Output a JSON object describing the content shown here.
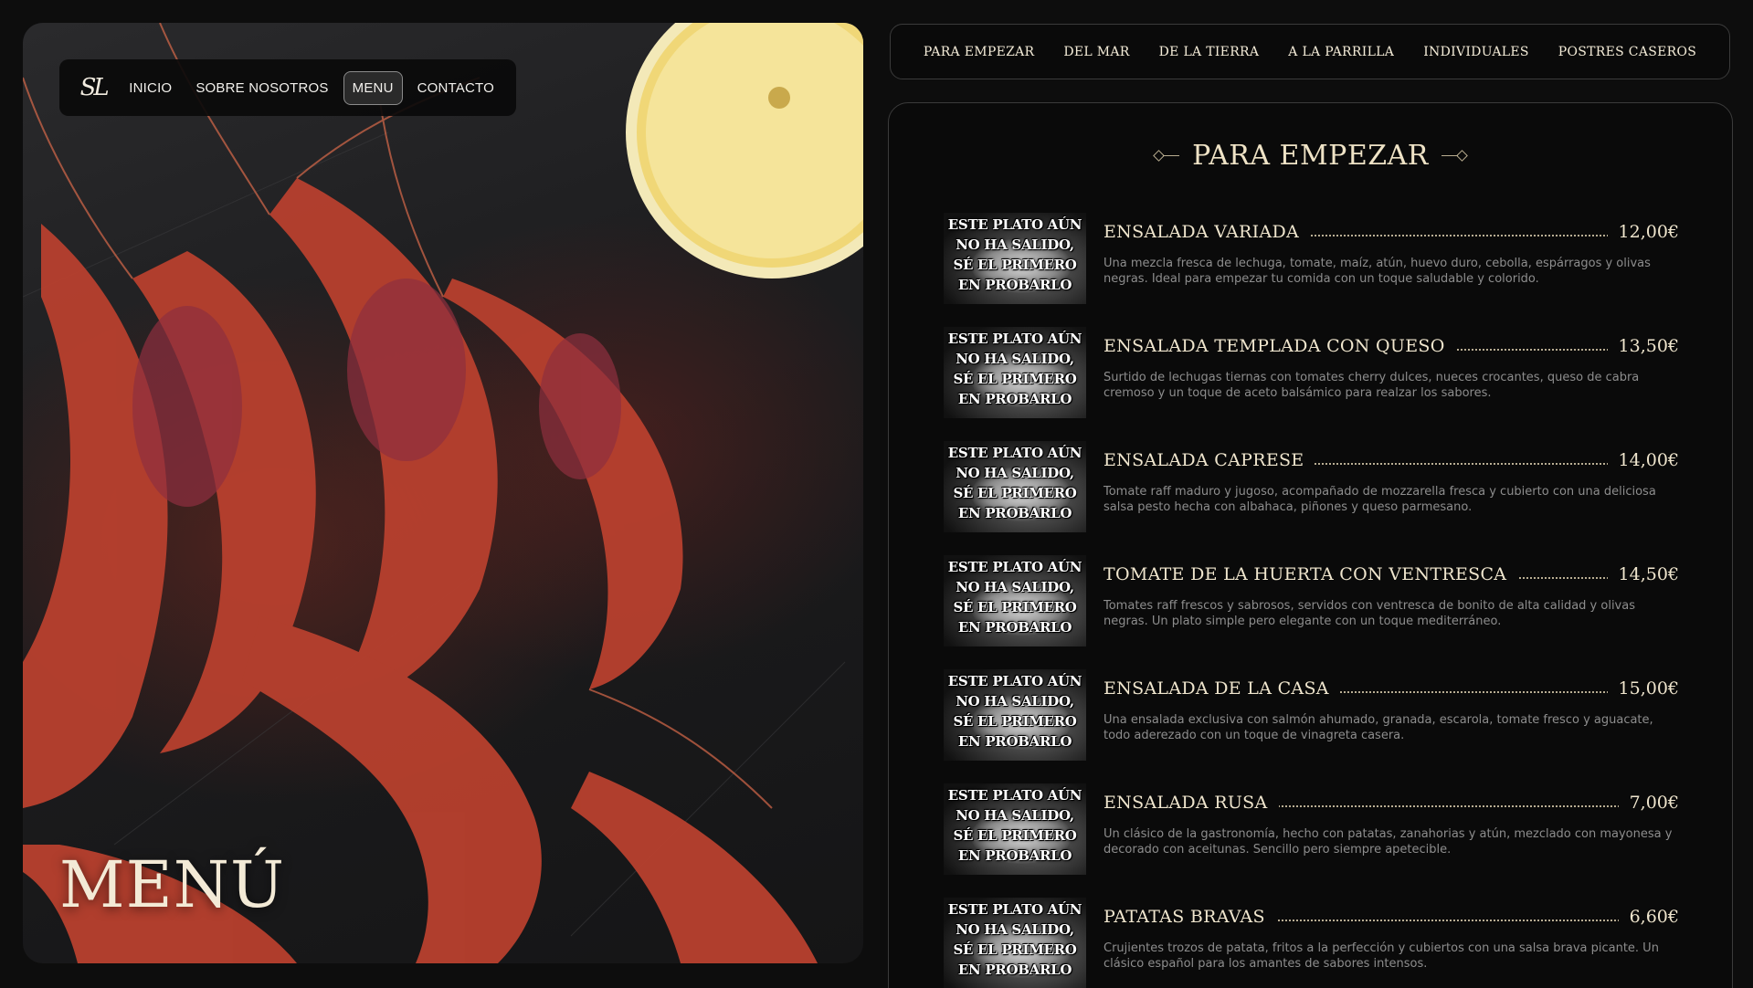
{
  "brand": {
    "logo_text": "SL"
  },
  "nav": {
    "items": [
      {
        "label": "INICIO"
      },
      {
        "label": "SOBRE NOSOTROS"
      },
      {
        "label": "MENU"
      },
      {
        "label": "CONTACTO"
      }
    ],
    "active": "MENU"
  },
  "hero": {
    "title": "MENÚ"
  },
  "categories": [
    {
      "label": "PARA EMPEZAR"
    },
    {
      "label": "DEL MAR"
    },
    {
      "label": "DE LA TIERRA"
    },
    {
      "label": "A LA PARRILLA"
    },
    {
      "label": "INDIVIDUALES"
    },
    {
      "label": "POSTRES CASEROS"
    }
  ],
  "section": {
    "title": "PARA EMPEZAR"
  },
  "placeholder_text": "ESTE PLATO AÚN NO HA SALIDO, SÉ EL PRIMERO EN PROBARLO",
  "dishes": [
    {
      "name": "ENSALADA VARIADA",
      "price": "12,00€",
      "description": "Una mezcla fresca de lechuga, tomate, maíz, atún, huevo duro, cebolla, espárragos y olivas negras. Ideal para empezar tu comida con un toque saludable y colorido."
    },
    {
      "name": "ENSALADA TEMPLADA CON QUESO",
      "price": "13,50€",
      "description": "Surtido de lechugas tiernas con tomates cherry dulces, nueces crocantes, queso de cabra cremoso y un toque de aceto balsámico para realzar los sabores."
    },
    {
      "name": "ENSALADA CAPRESE",
      "price": "14,00€",
      "description": "Tomate raff maduro y jugoso, acompañado de mozzarella fresca y cubierto con una deliciosa salsa pesto hecha con albahaca, piñones y queso parmesano."
    },
    {
      "name": "TOMATE DE LA HUERTA CON VENTRESCA",
      "price": "14,50€",
      "description": "Tomates raff frescos y sabrosos, servidos con ventresca de bonito de alta calidad y olivas negras. Un plato simple pero elegante con un toque mediterráneo."
    },
    {
      "name": "ENSALADA DE LA CASA",
      "price": "15,00€",
      "description": "Una ensalada exclusiva con salmón ahumado, granada, escarola, tomate fresco y aguacate, todo aderezado con un toque de vinagreta casera."
    },
    {
      "name": "ENSALADA RUSA",
      "price": "7,00€",
      "description": "Un clásico de la gastronomía, hecho con patatas, zanahorias y atún, mezclado con mayonesa y decorado con aceitunas. Sencillo pero siempre apetecible."
    },
    {
      "name": "PATATAS BRAVAS",
      "price": "6,60€",
      "description": "Crujientes trozos de patata, fritos a la perfección y cubiertos con una salsa brava picante. Un clásico español para los amantes de sabores intensos."
    }
  ]
}
